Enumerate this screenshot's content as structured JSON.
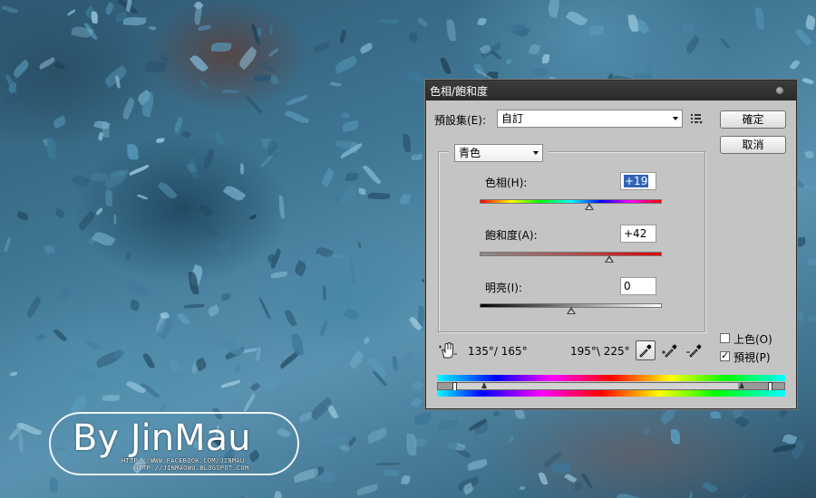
{
  "watermark": {
    "title": "By JinMau",
    "facebook": "HTTP://WWW.FACEBOOK.COM/JINMAU",
    "blog": "HTTP://JINMAOWU.BLOGSPOT.COM"
  },
  "dialog": {
    "title": "色相/飽和度",
    "preset_label": "預設集(E):",
    "preset_value": "自訂",
    "ok_label": "確定",
    "cancel_label": "取消",
    "channel_value": "青色",
    "hue": {
      "label": "色相(H):",
      "value": "+19",
      "position": 0.6
    },
    "saturation": {
      "label": "飽和度(A):",
      "value": "+42",
      "position": 0.71
    },
    "lightness": {
      "label": "明亮(I):",
      "value": "0",
      "position": 0.5
    },
    "range_left": "135°/ 165°",
    "range_right": "195°\\ 225°",
    "colorize_label": "上色(O)",
    "preview_label": "預視(P)",
    "colorize_checked": false,
    "preview_checked": true
  },
  "icons": {
    "close": "close-dot-icon",
    "preset_menu": "list-options-icon",
    "hand_adjust": "target-adjust-hand-icon",
    "eyedropper": "eyedropper-icon",
    "eyedropper_plus": "eyedropper-plus-icon",
    "eyedropper_minus": "eyedropper-minus-icon"
  },
  "colors": {
    "dialog_bg": "#c4c4c4",
    "titlebar": "#2f2f2f",
    "selection": "#2f64b8"
  }
}
